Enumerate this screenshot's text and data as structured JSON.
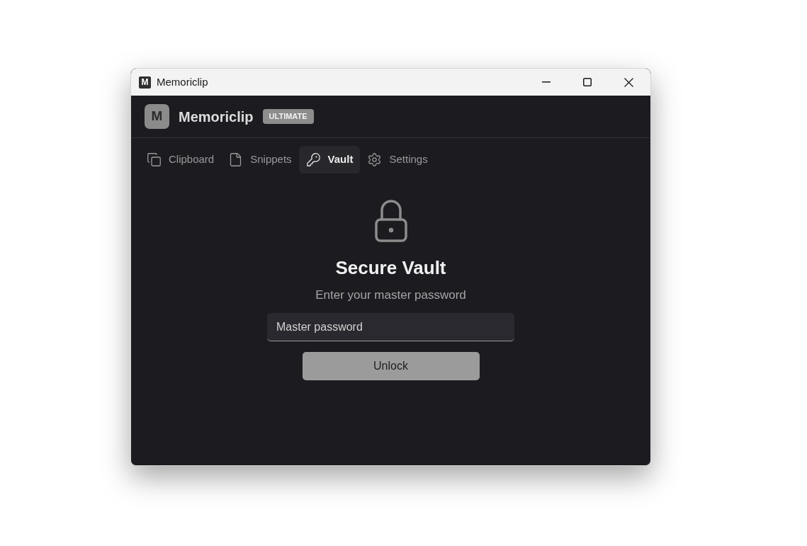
{
  "window": {
    "icon_letter": "M",
    "title": "Memoriclip"
  },
  "app_header": {
    "logo_letter": "M",
    "name": "Memoriclip",
    "badge": "ULTIMATE"
  },
  "tabs": [
    {
      "kind": "clipboard",
      "label": "Clipboard",
      "selected": false
    },
    {
      "kind": "snippets",
      "label": "Snippets",
      "selected": false
    },
    {
      "kind": "vault",
      "label": "Vault",
      "selected": true
    },
    {
      "kind": "settings",
      "label": "Settings",
      "selected": false
    }
  ],
  "vault": {
    "title": "Secure Vault",
    "subtitle": "Enter your master password",
    "password_field": {
      "placeholder": "Master password"
    },
    "unlock_button": "Unlock"
  }
}
